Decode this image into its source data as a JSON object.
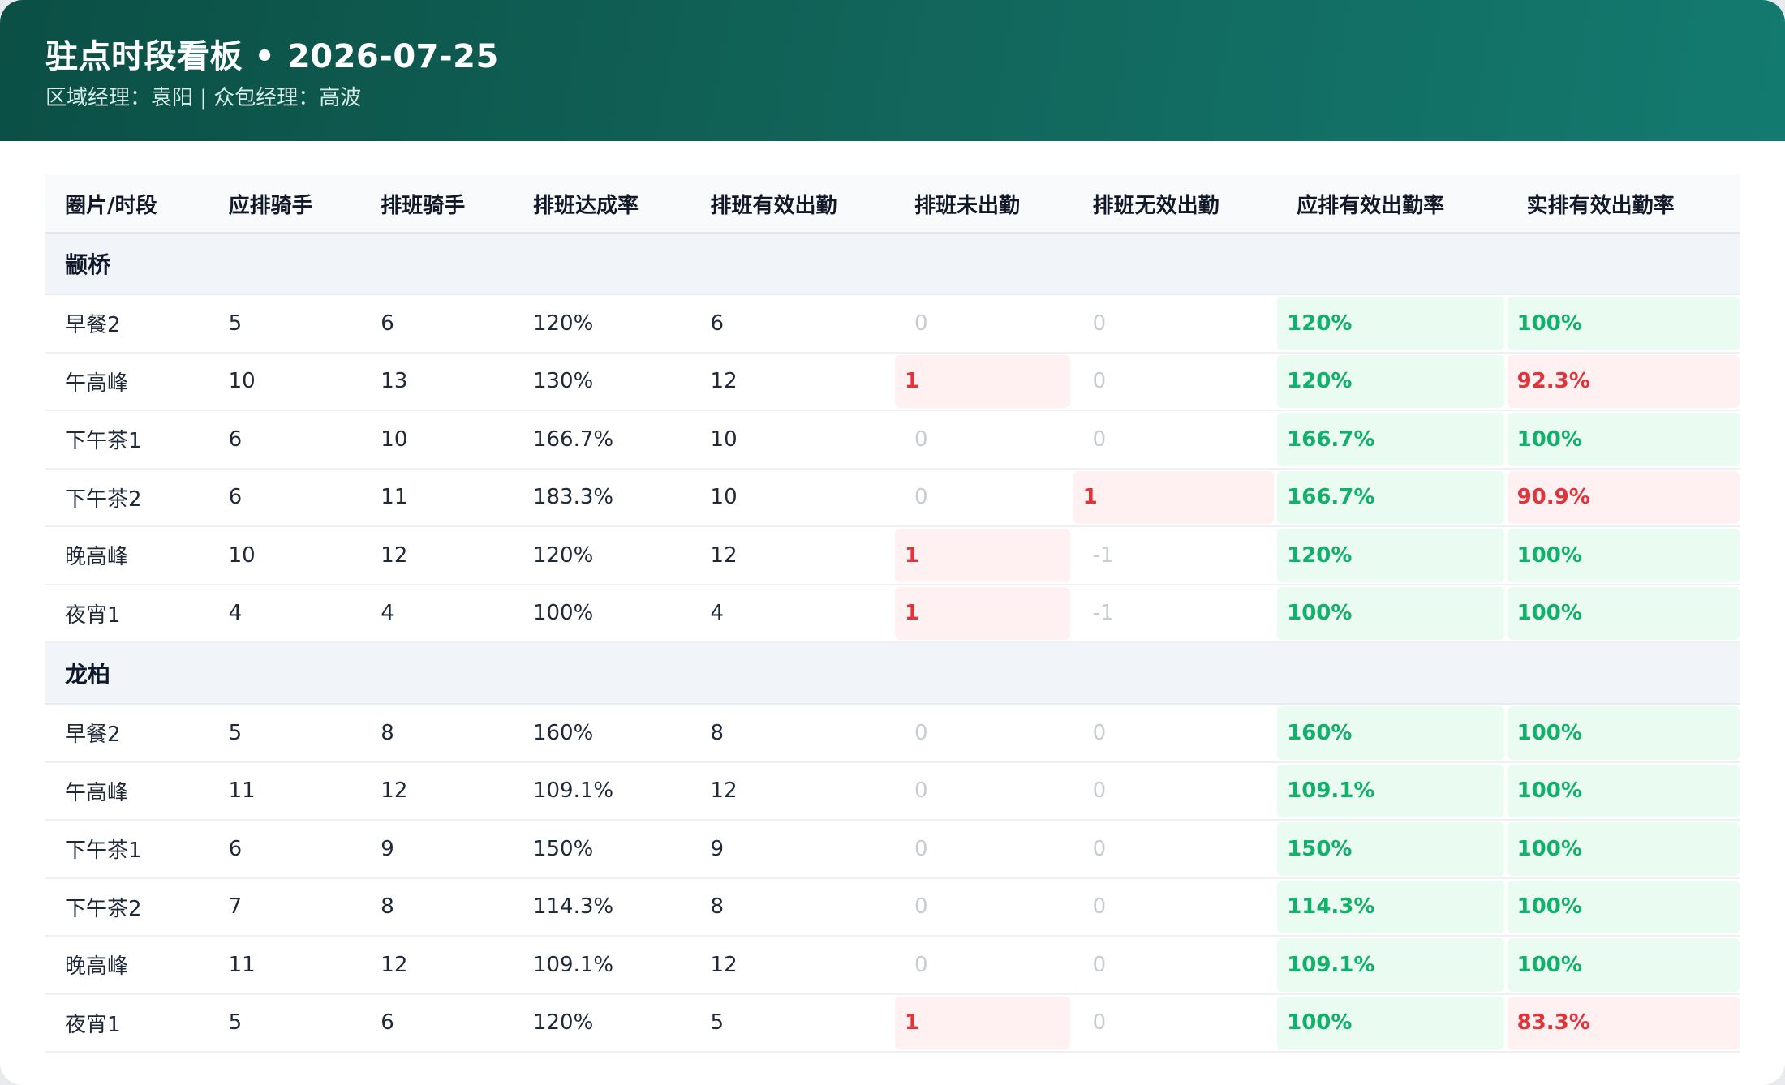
{
  "header": {
    "title": "驻点时段看板 • 2026-07-25",
    "subtitle": "区域经理：袁阳 | 众包经理：高波"
  },
  "columns": [
    "圈片/时段",
    "应排骑手",
    "排班骑手",
    "排班达成率",
    "排班有效出勤",
    "排班未出勤",
    "排班无效出勤",
    "应排有效出勤率",
    "实排有效出勤率"
  ],
  "colors": {
    "header_start": "#0b4f45",
    "header_end": "#137a70",
    "good_text": "#12b06a",
    "good_bg": "#eafbf2",
    "bad_text": "#e0343b",
    "bad_bg": "#fff1f1",
    "zero_text": "#c7ccd3"
  },
  "groups": [
    {
      "name": "颛桥",
      "rows": [
        {
          "slot": "早餐2",
          "need": "5",
          "scheduled": "6",
          "rate": "120%",
          "valid": "6",
          "absent": "0",
          "invalid": "0",
          "need_rate": "120%",
          "actual_rate": "100%"
        },
        {
          "slot": "午高峰",
          "need": "10",
          "scheduled": "13",
          "rate": "130%",
          "valid": "12",
          "absent": "1",
          "invalid": "0",
          "need_rate": "120%",
          "actual_rate": "92.3%"
        },
        {
          "slot": "下午茶1",
          "need": "6",
          "scheduled": "10",
          "rate": "166.7%",
          "valid": "10",
          "absent": "0",
          "invalid": "0",
          "need_rate": "166.7%",
          "actual_rate": "100%"
        },
        {
          "slot": "下午茶2",
          "need": "6",
          "scheduled": "11",
          "rate": "183.3%",
          "valid": "10",
          "absent": "0",
          "invalid": "1",
          "need_rate": "166.7%",
          "actual_rate": "90.9%"
        },
        {
          "slot": "晚高峰",
          "need": "10",
          "scheduled": "12",
          "rate": "120%",
          "valid": "12",
          "absent": "1",
          "invalid": "-1",
          "need_rate": "120%",
          "actual_rate": "100%"
        },
        {
          "slot": "夜宵1",
          "need": "4",
          "scheduled": "4",
          "rate": "100%",
          "valid": "4",
          "absent": "1",
          "invalid": "-1",
          "need_rate": "100%",
          "actual_rate": "100%"
        }
      ]
    },
    {
      "name": "龙柏",
      "rows": [
        {
          "slot": "早餐2",
          "need": "5",
          "scheduled": "8",
          "rate": "160%",
          "valid": "8",
          "absent": "0",
          "invalid": "0",
          "need_rate": "160%",
          "actual_rate": "100%"
        },
        {
          "slot": "午高峰",
          "need": "11",
          "scheduled": "12",
          "rate": "109.1%",
          "valid": "12",
          "absent": "0",
          "invalid": "0",
          "need_rate": "109.1%",
          "actual_rate": "100%"
        },
        {
          "slot": "下午茶1",
          "need": "6",
          "scheduled": "9",
          "rate": "150%",
          "valid": "9",
          "absent": "0",
          "invalid": "0",
          "need_rate": "150%",
          "actual_rate": "100%"
        },
        {
          "slot": "下午茶2",
          "need": "7",
          "scheduled": "8",
          "rate": "114.3%",
          "valid": "8",
          "absent": "0",
          "invalid": "0",
          "need_rate": "114.3%",
          "actual_rate": "100%"
        },
        {
          "slot": "晚高峰",
          "need": "11",
          "scheduled": "12",
          "rate": "109.1%",
          "valid": "12",
          "absent": "0",
          "invalid": "0",
          "need_rate": "109.1%",
          "actual_rate": "100%"
        },
        {
          "slot": "夜宵1",
          "need": "5",
          "scheduled": "6",
          "rate": "120%",
          "valid": "5",
          "absent": "1",
          "invalid": "0",
          "need_rate": "100%",
          "actual_rate": "83.3%"
        }
      ]
    }
  ]
}
